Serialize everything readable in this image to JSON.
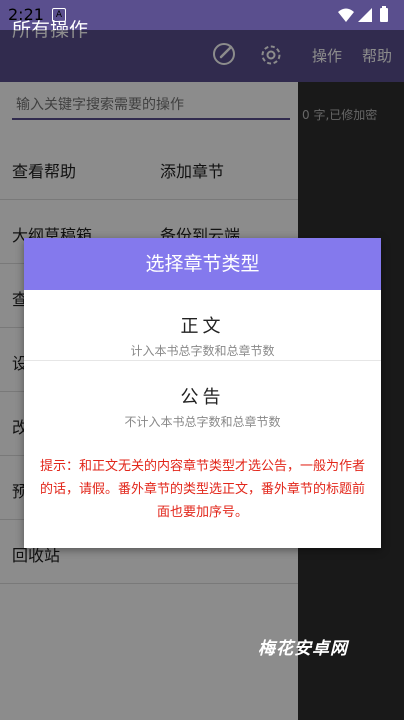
{
  "status": {
    "time": "2:21",
    "notif_letter": "A"
  },
  "appbar": {
    "title": "所有操作"
  },
  "right_bar": {
    "item1": "操作",
    "item2": "帮助",
    "hint": "0 字,已修加密"
  },
  "search": {
    "placeholder": "输入关键字搜索需要的操作"
  },
  "menu": {
    "row1_left": "查看帮助",
    "row1_right": "添加章节",
    "row2_left": "大纲草稿箱",
    "row2_right": "备份到云端",
    "row3_left": "查",
    "row4_left": "设",
    "row5_left": "改",
    "row6_left": "预",
    "row7_left": "回收站"
  },
  "dialog": {
    "title": "选择章节类型",
    "option1": {
      "title": "正文",
      "subtitle": "计入本书总字数和总章节数"
    },
    "option2": {
      "title": "公告",
      "subtitle": "不计入本书总字数和总章节数"
    },
    "hint": "提示：和正文无关的内容章节类型才选公告，一般为作者的话，请假。番外章节的类型选正文，番外章节的标题前面也要加序号。"
  },
  "watermark": "梅花安卓网",
  "colors": {
    "primary": "#5a4f8e",
    "dialog_header": "#8479ed",
    "hint_red": "#e2261a"
  }
}
